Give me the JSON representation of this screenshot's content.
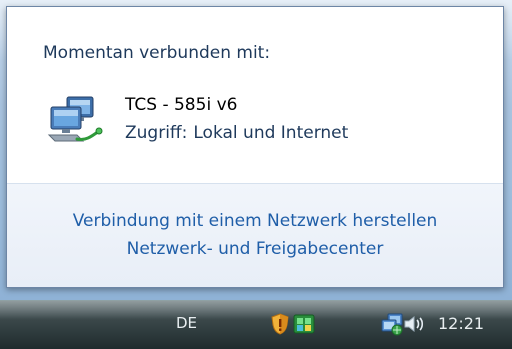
{
  "popup": {
    "heading": "Momentan verbunden mit:",
    "network": {
      "name": "TCS - 585i v6",
      "access_label": "Zugriff:",
      "access_value": "Lokal und Internet",
      "icon": "network-connected-icon"
    },
    "links": {
      "connect": "Verbindung mit einem Netzwerk herstellen",
      "center": "Netzwerk- und Freigabecenter"
    }
  },
  "taskbar": {
    "language": "DE",
    "clock": "12:21",
    "tray_icons": [
      "security-shield-icon",
      "task-manager-icon",
      "network-icon",
      "volume-icon"
    ]
  },
  "colors": {
    "link": "#1f5ea8",
    "heading": "#1e395b",
    "taskbar": "#2b3739"
  }
}
